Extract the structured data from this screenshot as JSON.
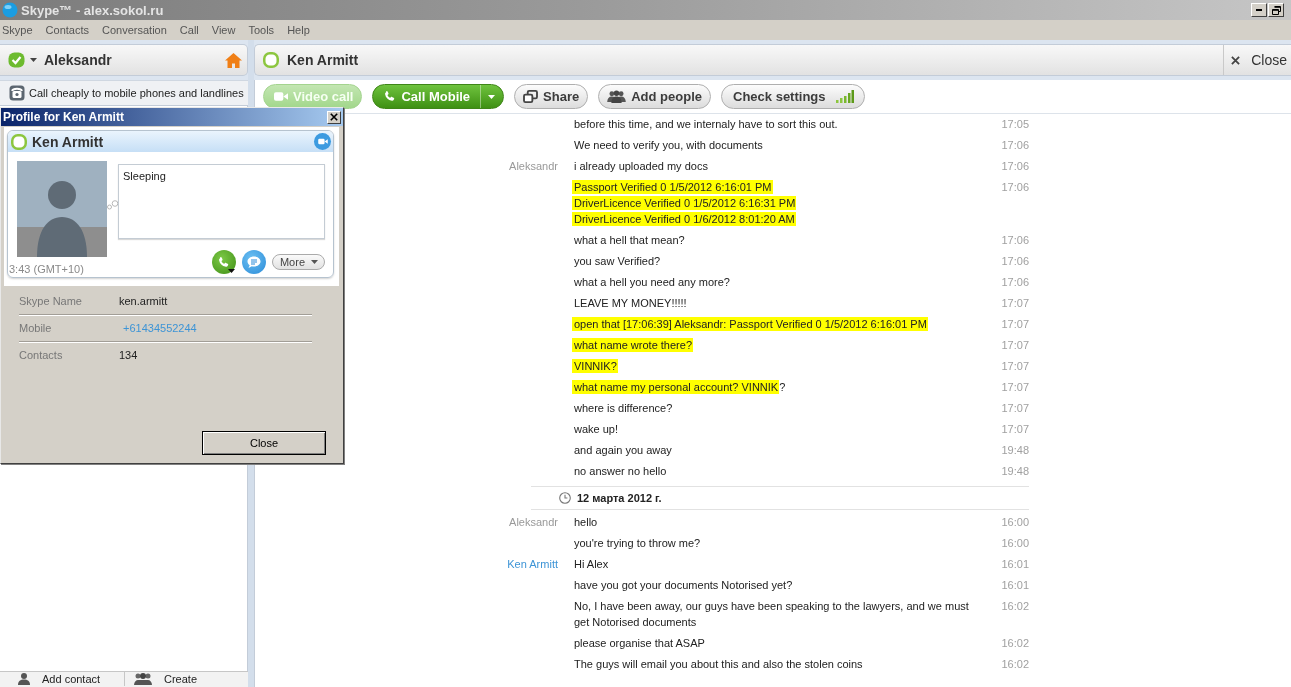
{
  "window": {
    "title": "Skype™ - alex.sokol.ru"
  },
  "menu": [
    "Skype",
    "Contacts",
    "Conversation",
    "Call",
    "View",
    "Tools",
    "Help"
  ],
  "sidebar": {
    "account": {
      "name": "Aleksandr"
    },
    "promo": "Call cheaply to mobile phones and landlines",
    "footer": [
      {
        "kind": "contact",
        "label": "Add contact"
      },
      {
        "kind": "group",
        "label": "Create"
      }
    ]
  },
  "conversation": {
    "title": "Ken Armitt",
    "close": "Close",
    "toolbar": [
      {
        "kind": "video",
        "label": "Video call",
        "disabled": true,
        "dropdown": false
      },
      {
        "kind": "call",
        "label": "Call Mobile",
        "disabled": false,
        "dropdown": true
      },
      {
        "kind": "share",
        "label": "Share",
        "disabled": false,
        "dropdown": false
      },
      {
        "kind": "people",
        "label": "Add people",
        "disabled": false,
        "dropdown": false
      },
      {
        "kind": "signal",
        "label": "Check settings",
        "disabled": false,
        "dropdown": false
      }
    ],
    "messages": [
      {
        "kind": "message",
        "segments": [
          {
            "text": "before this time, and we internaly have to sort this out.",
            "highlighted": false
          }
        ],
        "time": "17:05"
      },
      {
        "kind": "message",
        "segments": [
          {
            "text": "We need to verify you, with documents",
            "highlighted": false
          }
        ],
        "time": "17:06"
      },
      {
        "kind": "message",
        "sender": "Aleksandr",
        "color": "#999999",
        "segments": [
          {
            "text": "i already uploaded my docs",
            "highlighted": false
          }
        ],
        "time": "17:06"
      },
      {
        "kind": "message",
        "segments": [
          {
            "text": "Passport Verified 0 1/5/2012 6:16:01 PM\nDriverLicence Verified 0 1/5/2012 6:16:31 PM\nDriverLicence Verified 0 1/6/2012 8:01:20 AM",
            "highlighted": true
          }
        ],
        "time": "17:06"
      },
      {
        "kind": "message",
        "segments": [
          {
            "text": "what a hell that mean?",
            "highlighted": false
          }
        ],
        "time": "17:06"
      },
      {
        "kind": "message",
        "segments": [
          {
            "text": "you saw Verified?",
            "highlighted": false
          }
        ],
        "time": "17:06"
      },
      {
        "kind": "message",
        "segments": [
          {
            "text": "what a hell you need any more?",
            "highlighted": false
          }
        ],
        "time": "17:06"
      },
      {
        "kind": "message",
        "segments": [
          {
            "text": "LEAVE MY MONEY!!!!!",
            "highlighted": false
          }
        ],
        "time": "17:07"
      },
      {
        "kind": "message",
        "segments": [
          {
            "text": "open that [17:06:39] Aleksandr: Passport Verified 0 1/5/2012 6:16:01 PM",
            "highlighted": true
          }
        ],
        "time": "17:07"
      },
      {
        "kind": "message",
        "segments": [
          {
            "text": "what name wrote there?",
            "highlighted": true
          }
        ],
        "time": "17:07"
      },
      {
        "kind": "message",
        "segments": [
          {
            "text": "VINNIK?",
            "highlighted": true
          }
        ],
        "time": "17:07"
      },
      {
        "kind": "message",
        "segments": [
          {
            "text": "what name my personal account? VINNIK",
            "highlighted": true
          },
          {
            "text": "?",
            "highlighted": false
          }
        ],
        "time": "17:07"
      },
      {
        "kind": "message",
        "segments": [
          {
            "text": "where is difference?",
            "highlighted": false
          }
        ],
        "time": "17:07"
      },
      {
        "kind": "message",
        "segments": [
          {
            "text": "wake up!",
            "highlighted": false
          }
        ],
        "time": "17:07"
      },
      {
        "kind": "message",
        "segments": [
          {
            "text": "and again you away",
            "highlighted": false
          }
        ],
        "time": "19:48"
      },
      {
        "kind": "message",
        "segments": [
          {
            "text": "no answer no hello",
            "highlighted": false
          }
        ],
        "time": "19:48"
      },
      {
        "kind": "date",
        "text": "12 марта 2012 г."
      },
      {
        "kind": "message",
        "sender": "Aleksandr",
        "color": "#999999",
        "segments": [
          {
            "text": "hello",
            "highlighted": false
          }
        ],
        "time": "16:00"
      },
      {
        "kind": "message",
        "segments": [
          {
            "text": "you're trying to throw me?",
            "highlighted": false
          }
        ],
        "time": "16:00"
      },
      {
        "kind": "message",
        "sender": "Ken Armitt",
        "color": "#3d94d6",
        "segments": [
          {
            "text": "Hi Alex",
            "highlighted": false
          }
        ],
        "time": "16:01"
      },
      {
        "kind": "message",
        "segments": [
          {
            "text": "have you got your documents Notorised yet?",
            "highlighted": false
          }
        ],
        "time": "16:01"
      },
      {
        "kind": "message",
        "segments": [
          {
            "text": "No, I have been away, our guys have been speaking to the lawyers, and we must get Notorised documents",
            "highlighted": false
          }
        ],
        "time": "16:02"
      },
      {
        "kind": "message",
        "segments": [
          {
            "text": "please organise that ASAP",
            "highlighted": false
          }
        ],
        "time": "16:02"
      },
      {
        "kind": "message",
        "segments": [
          {
            "text": "The guys will email you about this and also the stolen coins",
            "highlighted": false
          }
        ],
        "time": "16:02"
      }
    ]
  },
  "profile_dialog": {
    "title": "Profile for Ken Armitt",
    "name": "Ken Armitt",
    "mood": "Sleeping",
    "local_time": "3:43 (GMT+10)",
    "more": "More",
    "fields": [
      {
        "kind": "text",
        "label": "Skype Name",
        "value": "ken.armitt"
      },
      {
        "kind": "link",
        "label": "Mobile",
        "value": "+61434552244"
      },
      {
        "kind": "text",
        "label": "Contacts",
        "value": "134"
      }
    ],
    "close": "Close"
  }
}
